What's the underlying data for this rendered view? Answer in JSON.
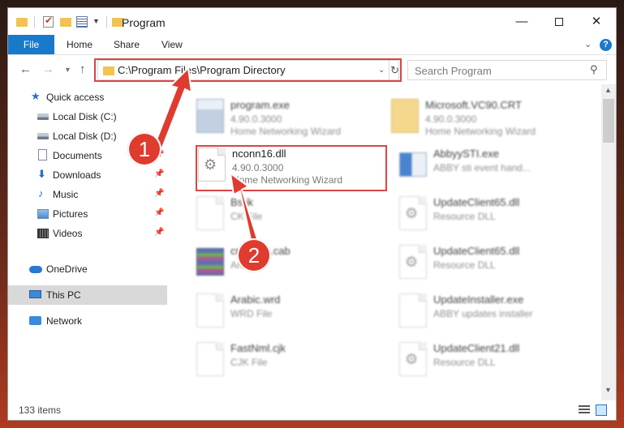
{
  "window": {
    "title": "Program",
    "controls": {
      "minimize": "—",
      "maximize": "",
      "close": "✕"
    }
  },
  "ribbon": {
    "tabs": [
      "File",
      "Home",
      "Share",
      "View"
    ],
    "help": "?"
  },
  "navigation": {
    "address": "C:\\Program Files\\Program Directory",
    "search_placeholder": "Search Program"
  },
  "sidebar": {
    "items": [
      {
        "label": "Quick access",
        "icon": "star-icon",
        "pinned": false
      },
      {
        "label": "Local Disk (C:)",
        "icon": "drive-icon",
        "pinned": false
      },
      {
        "label": "Local Disk (D:)",
        "icon": "drive-icon",
        "pinned": false
      },
      {
        "label": "Documents",
        "icon": "documents-icon",
        "pinned": true
      },
      {
        "label": "Downloads",
        "icon": "download-icon",
        "pinned": true
      },
      {
        "label": "Music",
        "icon": "music-icon",
        "pinned": true
      },
      {
        "label": "Pictures",
        "icon": "pictures-icon",
        "pinned": true
      },
      {
        "label": "Videos",
        "icon": "videos-icon",
        "pinned": true
      },
      {
        "label": "OneDrive",
        "icon": "cloud-icon",
        "pinned": false
      },
      {
        "label": "This PC",
        "icon": "computer-icon",
        "pinned": false,
        "selected": true
      },
      {
        "label": "Network",
        "icon": "network-icon",
        "pinned": false
      }
    ]
  },
  "files": [
    {
      "name": "program.exe",
      "line1": "4.90.0.3000",
      "line2": "Home Networking Wizard",
      "icon": "exe-icon"
    },
    {
      "name": "Microsoft.VC90.CRT",
      "line1": "4.90.0.3000",
      "line2": "Home Networking Wizard",
      "icon": "folder-icon"
    },
    {
      "name": "nconn16.dll",
      "line1": "4.90.0.3000",
      "line2": "Home Networking Wizard",
      "icon": "gear-document-icon"
    },
    {
      "name": "AbbyySTI.exe",
      "line1": "ABBY sti event hand...",
      "line2": "",
      "icon": "exe-icon"
    },
    {
      "name": "Bs.jk",
      "line1": "CK File",
      "line2": "",
      "icon": "document-icon"
    },
    {
      "name": "UpdateClient65.dll",
      "line1": "Resource DLL",
      "line2": "",
      "icon": "gear-document-icon"
    },
    {
      "name": "cmdates.cab",
      "line1": "Archive",
      "line2": "",
      "icon": "archive-icon"
    },
    {
      "name": "UpdateClient65.dll",
      "line1": "Resource DLL",
      "line2": "",
      "icon": "gear-document-icon"
    },
    {
      "name": "Arabic.wrd",
      "line1": "WRD File",
      "line2": "",
      "icon": "document-icon"
    },
    {
      "name": "UpdateInstaller.exe",
      "line1": "ABBY updates installer",
      "line2": "",
      "icon": "exe-icon"
    },
    {
      "name": "FastNml.cjk",
      "line1": "CJK File",
      "line2": "",
      "icon": "document-icon"
    },
    {
      "name": "UpdateClient21.dll",
      "line1": "Resource DLL",
      "line2": "",
      "icon": "gear-document-icon"
    }
  ],
  "status": {
    "item_count": "133 items"
  },
  "annotations": {
    "step1": "1",
    "step2": "2",
    "highlight_color": "#d94545",
    "marker_color": "#e03b2f"
  }
}
